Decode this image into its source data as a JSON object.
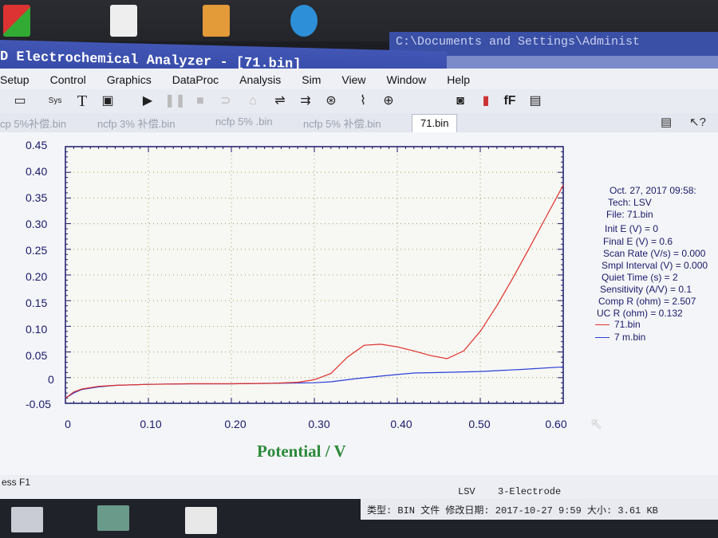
{
  "window": {
    "title": "D Electrochemical Analyzer - [71.bin]"
  },
  "other_window": {
    "title": "C:\\Documents and Settings\\Administ"
  },
  "menu": [
    "Setup",
    "Control",
    "Graphics",
    "DataProc",
    "Analysis",
    "Sim",
    "View",
    "Window",
    "Help"
  ],
  "toolbar": {
    "sys_label": "Sys",
    "text_tool": "T",
    "font_label": "fF"
  },
  "tabs": [
    "cp 5%补偿.bin",
    "ncfp 3% 补偿.bin",
    "ncfp 5% .bin",
    "ncfp 5% 补偿.bin",
    "71.bin"
  ],
  "active_tab": "71.bin",
  "info_panel": {
    "date": "Oct. 27, 2017   09:58:",
    "tech": "Tech: LSV",
    "file": "File: 71.bin",
    "params": [
      "Init E (V) = 0",
      "Final E (V) = 0.6",
      "Scan Rate (V/s) = 0.000",
      "Smpl Interval (V) = 0.000",
      "Quiet Time (s) = 2",
      "Sensitivity (A/V) = 0.1",
      "Comp R (ohm) = 2.507",
      "UC R (ohm) = 0.132"
    ]
  },
  "status": {
    "left": "ess F1",
    "technique": "LSV",
    "electrode": "3-Electrode"
  },
  "file_info": "类型: BIN 文件  修改日期: 2017-10-27 9:59  大小: 3.61 KB",
  "colors": {
    "series_red": "#e0302a",
    "series_blue": "#2a3fd8",
    "axis": "#1a1a6a",
    "xlabel": "#2b8a3a"
  },
  "chart_data": {
    "type": "line",
    "title": "",
    "xlabel": "Potential / V",
    "ylabel": "",
    "xlim": [
      0,
      0.6
    ],
    "ylim": [
      -0.05,
      0.45
    ],
    "xticks": [
      "0",
      "0.10",
      "0.20",
      "0.30",
      "0.40",
      "0.50",
      "0.60"
    ],
    "yticks": [
      "0.45",
      "0.40",
      "0.35",
      "0.30",
      "0.25",
      "0.20",
      "0.15",
      "0.10",
      "0.05",
      "0",
      "-0.05"
    ],
    "grid": true,
    "legend_position": "right",
    "series": [
      {
        "name": "71.bin",
        "color": "#e0302a",
        "x": [
          0,
          0.01,
          0.02,
          0.04,
          0.06,
          0.1,
          0.15,
          0.2,
          0.25,
          0.28,
          0.3,
          0.32,
          0.34,
          0.36,
          0.38,
          0.4,
          0.42,
          0.44,
          0.46,
          0.48,
          0.5,
          0.52,
          0.54,
          0.56,
          0.58,
          0.6
        ],
        "y": [
          -0.04,
          -0.028,
          -0.022,
          -0.017,
          -0.015,
          -0.013,
          -0.012,
          -0.012,
          -0.011,
          -0.009,
          -0.004,
          0.008,
          0.04,
          0.063,
          0.065,
          0.06,
          0.052,
          0.043,
          0.037,
          0.052,
          0.09,
          0.14,
          0.196,
          0.255,
          0.315,
          0.375
        ]
      },
      {
        "name": "7 m.bin",
        "color": "#2a3fd8",
        "x": [
          0,
          0.01,
          0.02,
          0.04,
          0.06,
          0.1,
          0.15,
          0.2,
          0.25,
          0.3,
          0.32,
          0.35,
          0.38,
          0.4,
          0.42,
          0.45,
          0.5,
          0.55,
          0.6
        ],
        "y": [
          -0.04,
          -0.03,
          -0.023,
          -0.018,
          -0.015,
          -0.013,
          -0.012,
          -0.012,
          -0.011,
          -0.01,
          -0.008,
          -0.002,
          0.003,
          0.006,
          0.009,
          0.01,
          0.012,
          0.016,
          0.021
        ]
      }
    ]
  }
}
